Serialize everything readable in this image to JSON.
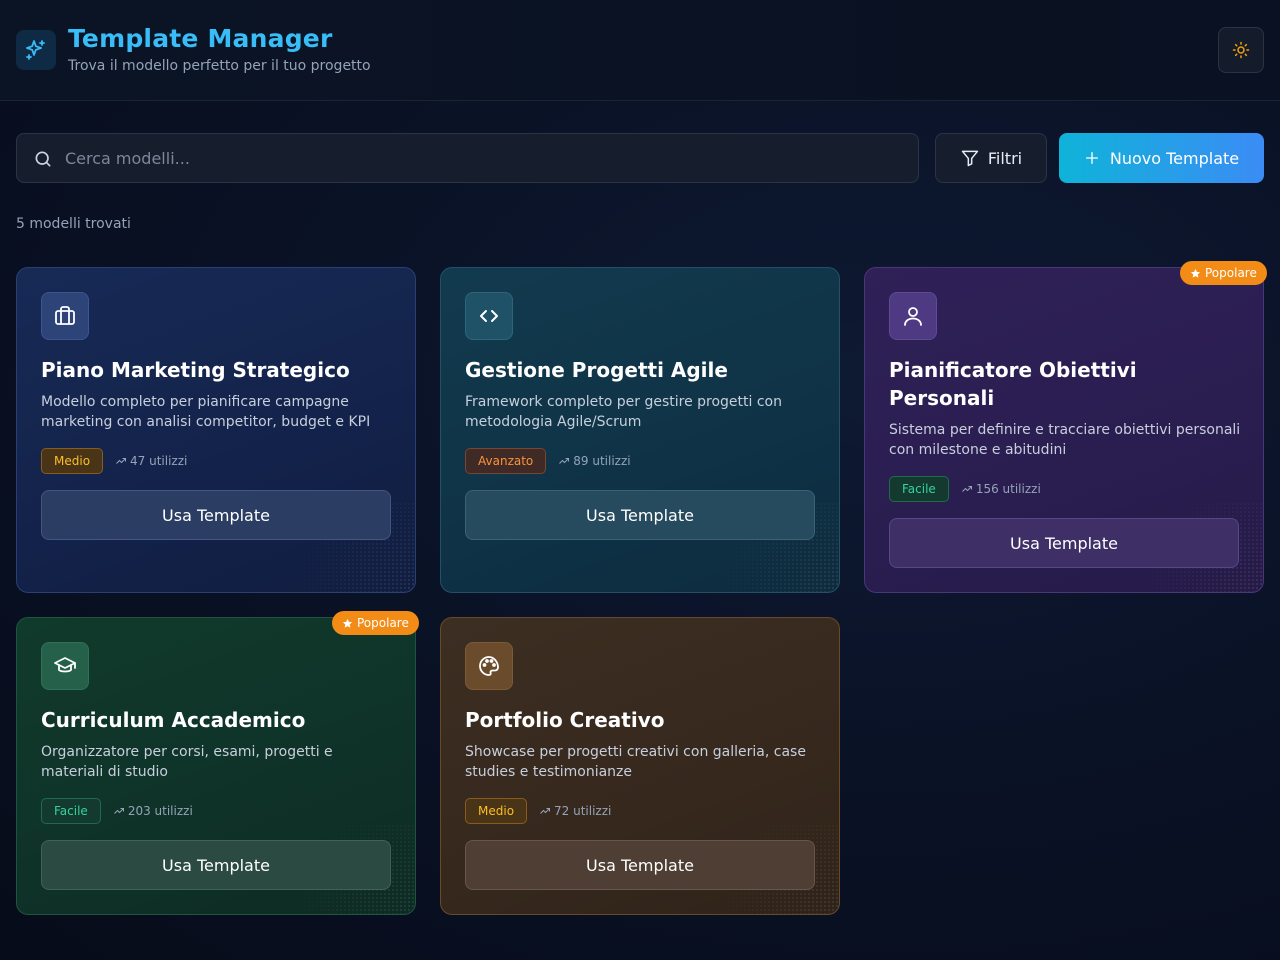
{
  "header": {
    "title": "Template Manager",
    "subtitle": "Trova il modello perfetto per il tuo progetto"
  },
  "toolbar": {
    "search_placeholder": "Cerca modelli...",
    "filter_label": "Filtri",
    "new_label": "Nuovo Template"
  },
  "results": {
    "count_text": "5 modelli trovati"
  },
  "templates": [
    {
      "icon": "briefcase-icon",
      "title": "Piano Marketing Strategico",
      "description": "Modello completo per pianificare campagne marketing con analisi competitor, budget e KPI",
      "difficulty": "Medio",
      "usage": "47 utilizzi",
      "button": "Usa Template",
      "popular": false
    },
    {
      "icon": "code-icon",
      "title": "Gestione Progetti Agile",
      "description": "Framework completo per gestire progetti con metodologia Agile/Scrum",
      "difficulty": "Avanzato",
      "usage": "89 utilizzi",
      "button": "Usa Template",
      "popular": false
    },
    {
      "icon": "user-icon",
      "title": "Pianificatore Obiettivi Personali",
      "description": "Sistema per definire e tracciare obiettivi personali con milestone e abitudini",
      "difficulty": "Facile",
      "usage": "156 utilizzi",
      "button": "Usa Template",
      "popular": true,
      "popular_label": "Popolare"
    },
    {
      "icon": "graduation-cap-icon",
      "title": "Curriculum Accademico",
      "description": "Organizzatore per corsi, esami, progetti e materiali di studio",
      "difficulty": "Facile",
      "usage": "203 utilizzi",
      "button": "Usa Template",
      "popular": true,
      "popular_label": "Popolare"
    },
    {
      "icon": "palette-icon",
      "title": "Portfolio Creativo",
      "description": "Showcase per progetti creativi con galleria, case studies e testimonianze",
      "difficulty": "Medio",
      "usage": "72 utilizzi",
      "button": "Usa Template",
      "popular": false
    }
  ],
  "colors": {
    "accent": "#38bdf8",
    "primary_button_start": "#0fb3d9",
    "primary_button_end": "#3b8cf5",
    "popular_badge": "#f28c16",
    "theme_icon": "#f59e0b"
  }
}
